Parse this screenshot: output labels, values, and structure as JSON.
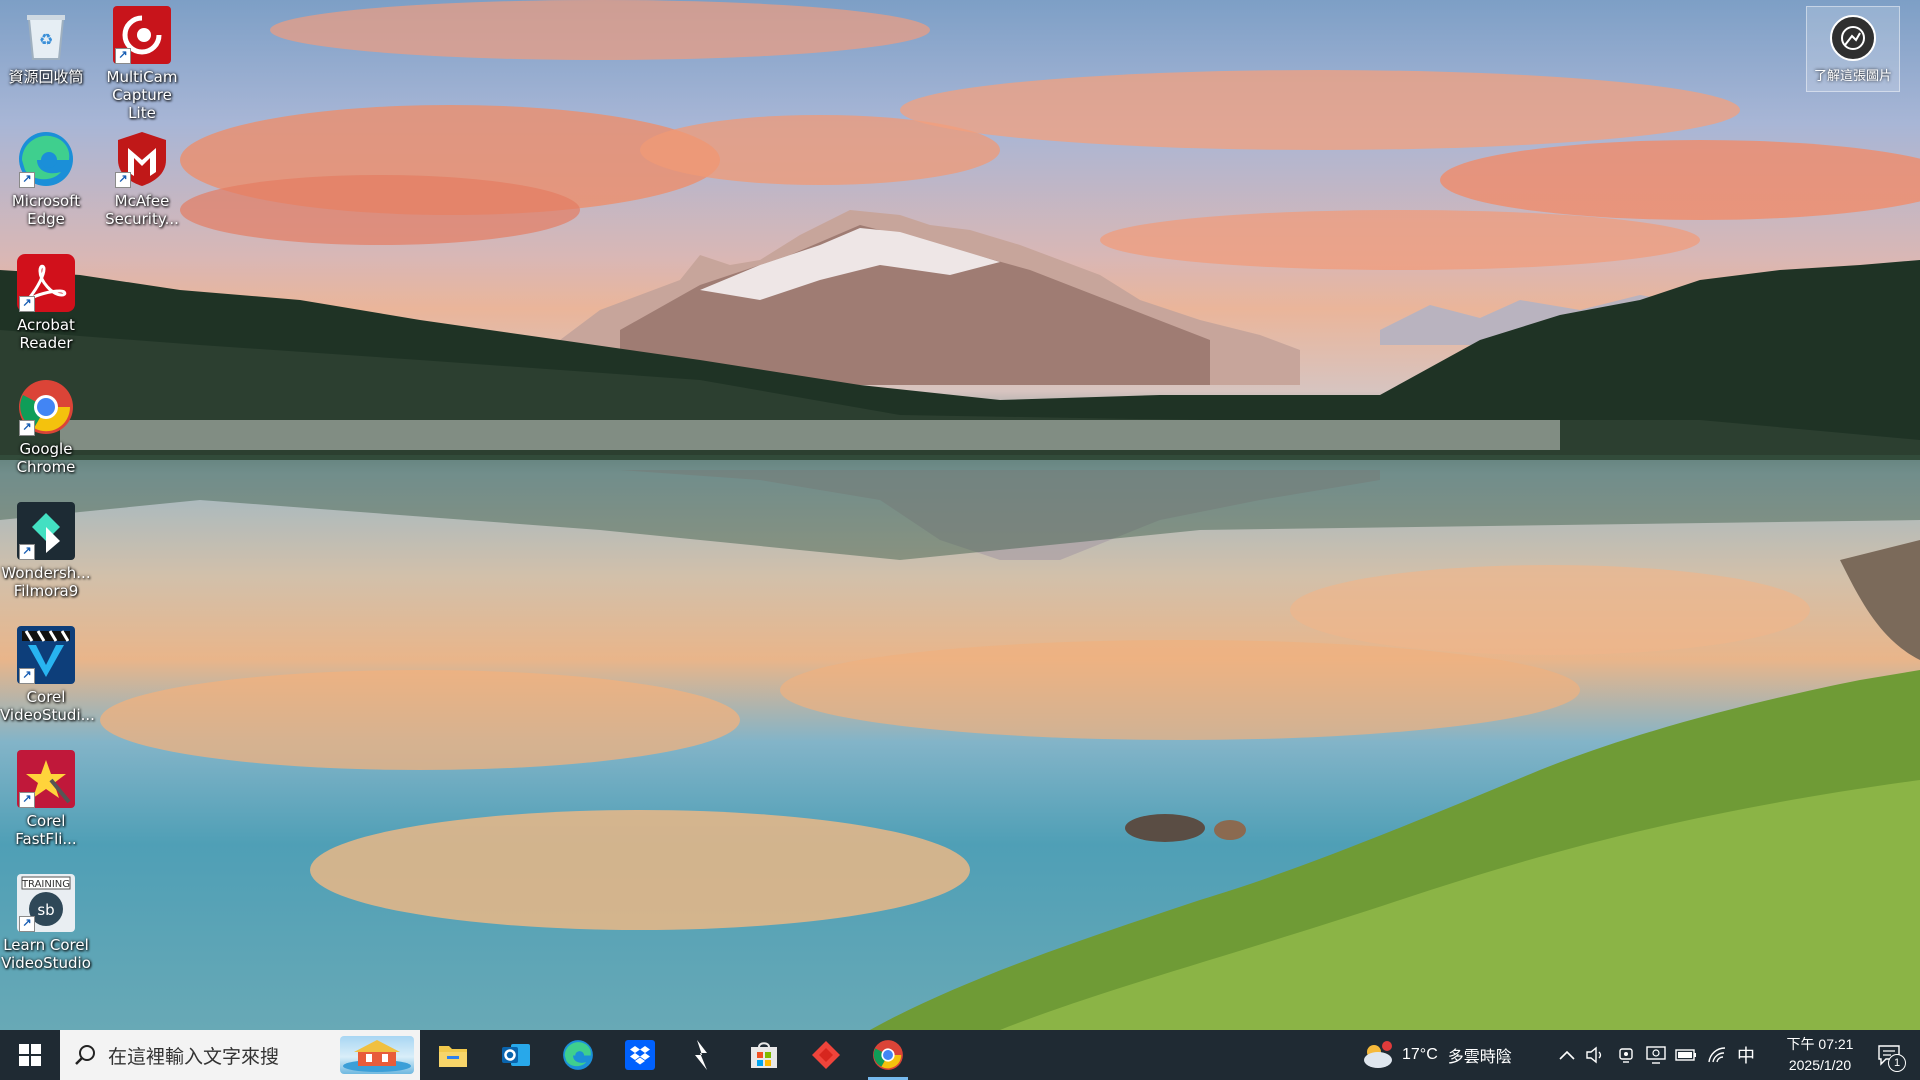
{
  "desktop": {
    "icons": [
      {
        "label": "資源回收筒",
        "icon": "recycle-bin-icon"
      },
      {
        "label": "MultiCam Capture Lite",
        "icon": "multicam-icon"
      },
      {
        "label": "Microsoft Edge",
        "icon": "edge-icon"
      },
      {
        "label": "McAfee Security...",
        "icon": "mcafee-icon"
      },
      {
        "label": "Acrobat Reader",
        "icon": "acrobat-icon"
      },
      {
        "label": "Google Chrome",
        "icon": "chrome-icon"
      },
      {
        "label": "Wondersh... Filmora9",
        "icon": "filmora-icon"
      },
      {
        "label": "Corel VideoStudi...",
        "icon": "corel-videostudio-icon"
      },
      {
        "label": "Corel FastFli...",
        "icon": "corel-fastflick-icon"
      },
      {
        "label": "Learn Corel VideoStudio",
        "icon": "learn-corel-icon"
      }
    ],
    "info_button": {
      "label": "了解這張圖片",
      "icon": "camera-info-icon"
    }
  },
  "taskbar": {
    "search_placeholder": "在這裡輸入文字來搜",
    "apps": [
      "file-explorer-icon",
      "outlook-icon",
      "edge-icon",
      "dropbox-icon",
      "lightning-app-icon",
      "microsoft-store-icon",
      "anydesk-icon",
      "chrome-icon"
    ],
    "active_app": "chrome-icon",
    "weather": {
      "temp": "17°C",
      "condition": "多雲時陰"
    },
    "ime": "中",
    "clock": {
      "time": "下午 07:21",
      "date": "2025/1/20"
    },
    "notifications_count": "1"
  },
  "colors": {
    "taskbar_bg": "#1f2a33",
    "active_indicator": "#76b9ed"
  }
}
